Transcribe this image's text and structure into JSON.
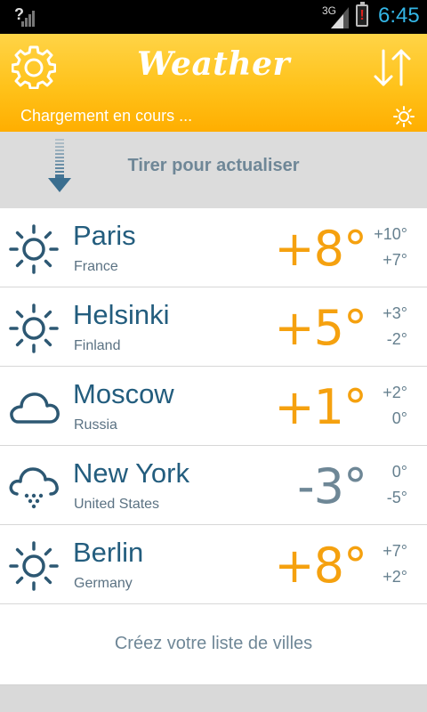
{
  "status_bar": {
    "unknown": "?",
    "network": "3G",
    "battery": "!",
    "time": "6:45"
  },
  "header": {
    "title": "Weather",
    "loading": "Chargement en cours ...",
    "settings_icon": "gear-icon",
    "sort_icon": "sort-arrows-icon"
  },
  "pull": {
    "label": "Tirer pour actualiser"
  },
  "cities": [
    {
      "name": "Paris",
      "country": "France",
      "temp": "+8°",
      "high": "+10°",
      "low": "+7°",
      "icon": "sun-icon"
    },
    {
      "name": "Helsinki",
      "country": "Finland",
      "temp": "+5°",
      "high": "+3°",
      "low": "-2°",
      "icon": "sun-icon"
    },
    {
      "name": "Moscow",
      "country": "Russia",
      "temp": "+1°",
      "high": "+2°",
      "low": "0°",
      "icon": "cloud-icon"
    },
    {
      "name": "New York",
      "country": "United States",
      "temp": "-3°",
      "high": "0°",
      "low": "-5°",
      "icon": "snow-cloud-icon"
    },
    {
      "name": "Berlin",
      "country": "Germany",
      "temp": "+8°",
      "high": "+7°",
      "low": "+2°",
      "icon": "sun-icon"
    }
  ],
  "create_list": "Créez votre liste de villes",
  "colors": {
    "accent": "#ffc21a",
    "warm_temp": "#f5a10f",
    "cold_temp": "#6e8796",
    "city_text": "#235d7e"
  }
}
